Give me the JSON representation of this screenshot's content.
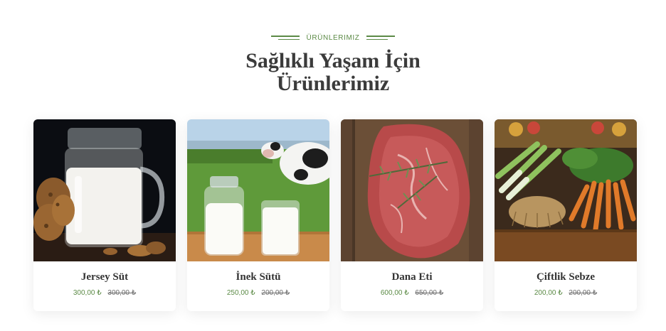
{
  "section": {
    "eyebrow": "ÜRÜNLERIMIZ",
    "title_line1": "Sağlıklı Yaşam İçin",
    "title_line2": "Ürünlerimiz"
  },
  "colors": {
    "accent": "#5b8a45",
    "title": "#3b3b3b"
  },
  "products": [
    {
      "name": "Jersey Süt",
      "price": "300,00 ₺",
      "old_price": "300,00 ₺",
      "image": "milk-jar-cookies"
    },
    {
      "name": "İnek Sütü",
      "price": "250,00 ₺",
      "old_price": "200,00 ₺",
      "image": "cow-milk-glass"
    },
    {
      "name": "Dana Eti",
      "price": "600,00 ₺",
      "old_price": "650,00 ₺",
      "image": "raw-beef-rosemary"
    },
    {
      "name": "Çiftlik Sebze",
      "price": "200,00 ₺",
      "old_price": "200,00 ₺",
      "image": "farm-vegetables"
    }
  ]
}
